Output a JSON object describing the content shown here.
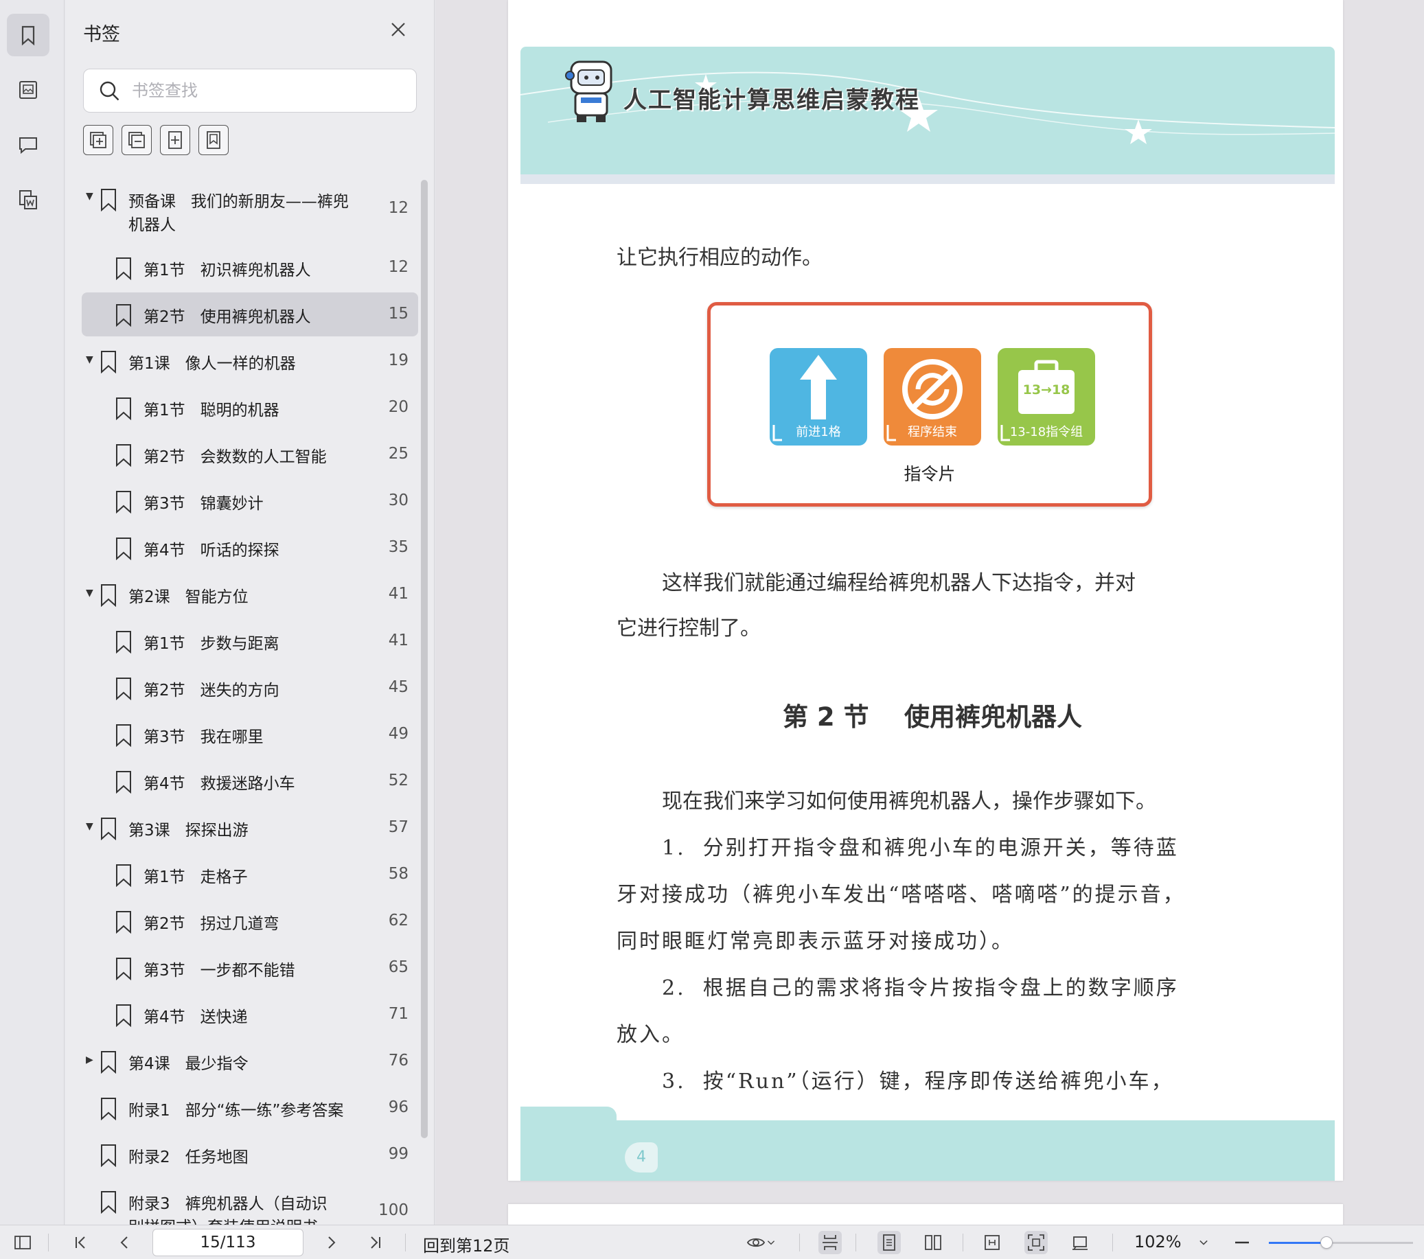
{
  "sidebar": {
    "title": "书签",
    "search_placeholder": "书签查找",
    "tools": [
      {
        "icon": "expand-all-icon"
      },
      {
        "icon": "collapse-all-icon"
      },
      {
        "icon": "add-bookmark-icon"
      },
      {
        "icon": "bookmark-outline-icon"
      }
    ],
    "bookmarks": [
      {
        "level": 0,
        "caret": "down",
        "label": "预备课   我们的新朋友——裤兜",
        "label2": "机器人",
        "page": "12"
      },
      {
        "level": 1,
        "caret": "",
        "label": "第1节   初识裤兜机器人",
        "page": "12"
      },
      {
        "level": 1,
        "caret": "",
        "label": "第2节   使用裤兜机器人",
        "page": "15",
        "selected": true
      },
      {
        "level": 0,
        "caret": "down",
        "label": "第1课   像人一样的机器",
        "page": "19"
      },
      {
        "level": 1,
        "caret": "",
        "label": "第1节   聪明的机器",
        "page": "20"
      },
      {
        "level": 1,
        "caret": "",
        "label": "第2节   会数数的人工智能",
        "page": "25"
      },
      {
        "level": 1,
        "caret": "",
        "label": "第3节   锦囊妙计",
        "page": "30"
      },
      {
        "level": 1,
        "caret": "",
        "label": "第4节   听话的探探",
        "page": "35"
      },
      {
        "level": 0,
        "caret": "down",
        "label": "第2课   智能方位",
        "page": "41"
      },
      {
        "level": 1,
        "caret": "",
        "label": "第1节   步数与距离",
        "page": "41"
      },
      {
        "level": 1,
        "caret": "",
        "label": "第2节   迷失的方向",
        "page": "45"
      },
      {
        "level": 1,
        "caret": "",
        "label": "第3节   我在哪里",
        "page": "49"
      },
      {
        "level": 1,
        "caret": "",
        "label": "第4节   救援迷路小车",
        "page": "52"
      },
      {
        "level": 0,
        "caret": "down",
        "label": "第3课   探探出游",
        "page": "57"
      },
      {
        "level": 1,
        "caret": "",
        "label": "第1节   走格子",
        "page": "58"
      },
      {
        "level": 1,
        "caret": "",
        "label": "第2节   拐过几道弯",
        "page": "62"
      },
      {
        "level": 1,
        "caret": "",
        "label": "第3节   一步都不能错",
        "page": "65"
      },
      {
        "level": 1,
        "caret": "",
        "label": "第4节   送快递",
        "page": "71"
      },
      {
        "level": 0,
        "caret": "right",
        "label": "第4课   最少指令",
        "page": "76"
      },
      {
        "level": 0,
        "caret": "",
        "label": "附录1   部分“练一练”参考答案",
        "page": "96"
      },
      {
        "level": 0,
        "caret": "",
        "label": "附录2   任务地图",
        "page": "99"
      },
      {
        "level": 0,
        "caret": "",
        "label": "附录3   裤兜机器人（自动识",
        "label2": "别拼图式）套装使用说明书",
        "page": "100"
      }
    ]
  },
  "document": {
    "header_title": "人工智能计算思维启蒙教程",
    "para1": "让它执行相应的动作。",
    "figure": {
      "cards": [
        {
          "label": "前进1格",
          "color": "#4fb6e2",
          "icon": "arrow-up-icon"
        },
        {
          "label": "程序结束",
          "color": "#ef8a3a",
          "icon": "stop-loop-icon"
        },
        {
          "label": "13-18指令组",
          "color": "#97c64a",
          "icon": "briefcase-icon",
          "badge": "13→18"
        }
      ],
      "caption": "指令片"
    },
    "para2_line1": "这样我们就能通过编程给裤兜机器人下达指令，并对",
    "para2_line2": "它进行控制了。",
    "section_heading": "第 2 节    使用裤兜机器人",
    "para3": "现在我们来学习如何使用裤兜机器人，操作步骤如下。",
    "step1_line1": "1.  分别打开指令盘和裤兜小车的电源开关，等待蓝",
    "step1_line2": "牙对接成功（裤兜小车发出“嗒嗒嗒、嗒嘀嗒”的提示音，",
    "step1_line3": "同时眼眶灯常亮即表示蓝牙对接成功）。",
    "step2_line1": "2.  根据自己的需求将指令片按指令盘上的数字顺序",
    "step2_line2": "放入。",
    "step3_line1": "3.  按“Run”（运行）键，程序即传送给裤兜小车，",
    "page_number": "4",
    "colors": {
      "header_band": "#b9e4e2",
      "figure_border": "#e05c43"
    }
  },
  "statusbar": {
    "page_field": "15/113",
    "goto_label": "回到第12页",
    "zoom_label": "102%",
    "zoom_level": 0.4
  }
}
